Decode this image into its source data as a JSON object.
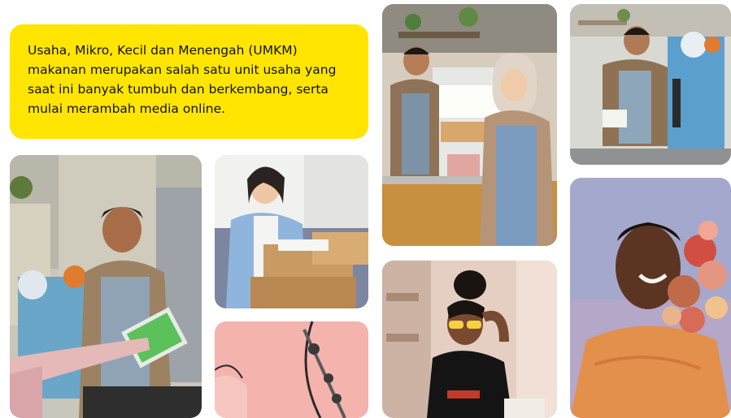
{
  "intro": {
    "text": "Usaha, Mikro, Kecil dan Menengah (UMKM) makanan merupakan salah satu unit usaha yang saat ini banyak tumbuh dan berkembang, serta mulai merambah media online."
  },
  "photos": [
    {
      "id": "photo-vendor-tablet",
      "subject": "young man in apron at drink stall taking tablet payment"
    },
    {
      "id": "photo-woman-packages",
      "subject": "smiling woman on phone with cardboard packages"
    },
    {
      "id": "photo-pink-machine",
      "subject": "sealing machine against pink background"
    },
    {
      "id": "photo-food-stall-couple",
      "subject": "man and hijab woman in aprons at food stall counter"
    },
    {
      "id": "photo-woman-sunglasses",
      "subject": "woman with sunglasses leaning in cafe"
    },
    {
      "id": "photo-man-sealer",
      "subject": "man operating cup sealing machine"
    },
    {
      "id": "photo-man-flowers",
      "subject": "laughing man holding flowers"
    }
  ],
  "colors": {
    "accent": "#ffe500",
    "text": "#111111",
    "background": "#ffffff"
  }
}
